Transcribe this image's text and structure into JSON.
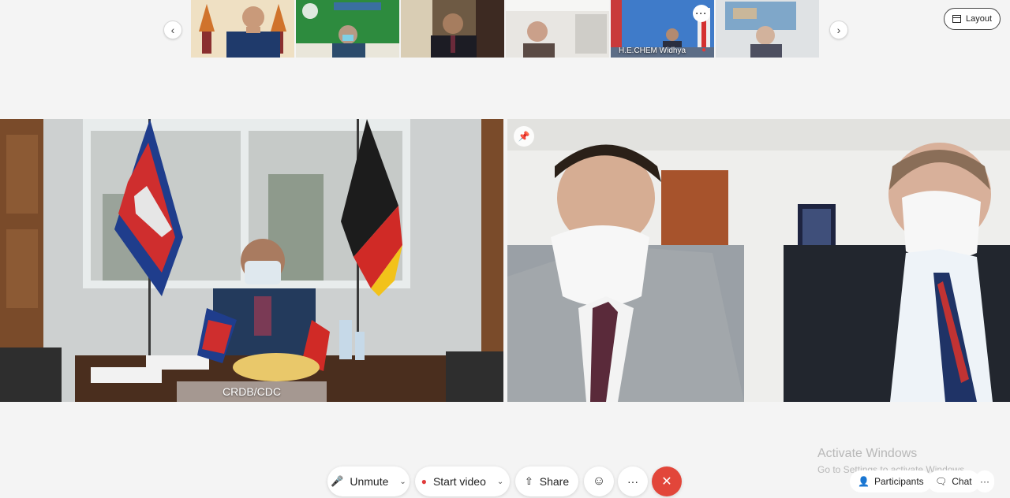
{
  "filmstrip": {
    "prev_icon": "chevron-left-icon",
    "next_icon": "chevron-right-icon",
    "thumbnails": [
      {
        "name": ""
      },
      {
        "name": ""
      },
      {
        "name": ""
      },
      {
        "name": ""
      },
      {
        "name": "H.E.CHEM Widhya",
        "muted": true,
        "has_more": true,
        "more_label": "···"
      },
      {
        "name": ""
      }
    ]
  },
  "header": {
    "layout_label": "Layout",
    "layout_icon": "layout-icon"
  },
  "main": {
    "left_tile_label": "CRDB/CDC",
    "pin_icon": "pin-icon"
  },
  "controls": {
    "unmute_label": "Unmute",
    "start_video_label": "Start video",
    "share_label": "Share",
    "reactions_icon": "smiley-icon",
    "more_label": "···",
    "leave_icon": "close-icon",
    "participants_label": "Participants",
    "chat_label": "Chat",
    "panel_more_label": "···",
    "leave_color": "#e2463a",
    "mic_muted_color": "#e03a3a"
  },
  "watermark": {
    "title": "Activate Windows",
    "subtitle": "Go to Settings to activate Windows."
  }
}
